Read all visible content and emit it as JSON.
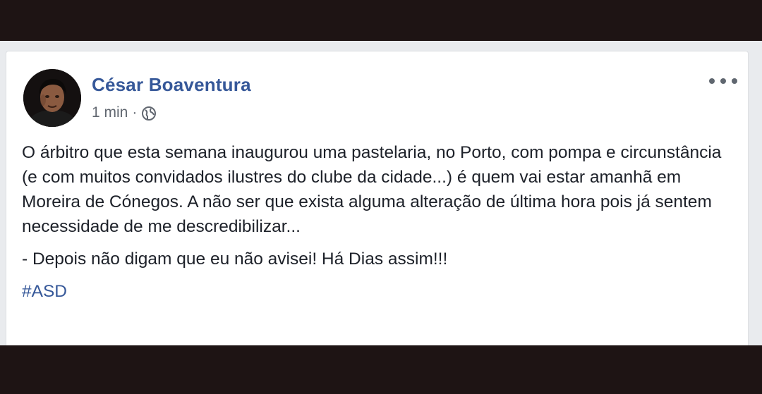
{
  "post": {
    "author_name": "César Boaventura",
    "timestamp": "1 min",
    "separator": "·",
    "privacy_icon": "globe-icon",
    "menu_icon": "more-options-icon",
    "body_paragraph_1": "O árbitro que esta semana inaugurou uma pastelaria, no Porto, com pompa e circunstância (e com muitos convidados ilustres do clube da cidade...) é quem vai estar amanhã em Moreira de Cónegos. A não ser que exista alguma alteração de última hora pois já sentem necessidade de me descredibilizar...",
    "body_paragraph_2": "- Depois não digam que eu não avisei! Há Dias assim!!!",
    "hashtag": "#ASD"
  },
  "colors": {
    "author_link": "#365899",
    "body_text": "#1d2129",
    "meta_text": "#616770",
    "card_bg": "#ffffff",
    "feed_bg": "#e9ebee",
    "frame_bg": "#1e1414"
  }
}
